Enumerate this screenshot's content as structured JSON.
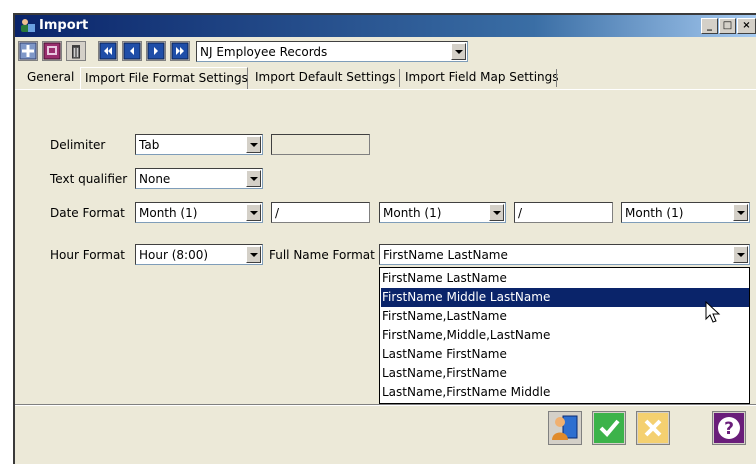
{
  "window": {
    "title": "Import",
    "controls": [
      "_",
      "□",
      "×"
    ]
  },
  "toolbar": {
    "record_select": {
      "value": "NJ Employee Records"
    }
  },
  "tabs": [
    {
      "label": "General",
      "active": false
    },
    {
      "label": "Import File Format Settings",
      "active": true
    },
    {
      "label": "Import Default Settings",
      "active": false
    },
    {
      "label": "Import Field Map Settings",
      "active": false
    }
  ],
  "form": {
    "delimiter": {
      "label": "Delimiter",
      "value": "Tab",
      "other": ""
    },
    "text_qualifier": {
      "label": "Text qualifier",
      "value": "None"
    },
    "date_format": {
      "label": "Date Format",
      "part1": "Month (1)",
      "sep1": "/",
      "part2": "Month (1)",
      "sep2": "/",
      "part3": "Month (1)"
    },
    "hour_format": {
      "label": "Hour Format",
      "value": "Hour (8:00)"
    },
    "full_name_format": {
      "label": "Full Name Format",
      "value": "FirstName LastName",
      "options": [
        "FirstName LastName",
        "FirstName Middle LastName",
        "FirstName,LastName",
        "FirstName,Middle,LastName",
        "LastName FirstName",
        "LastName,FirstName",
        "LastName,FirstName Middle"
      ],
      "highlighted_index": 1
    }
  },
  "colors": {
    "title_gradient_start": "#0a246a",
    "highlight": "#0a246a",
    "window_bg": "#ece9d8"
  }
}
